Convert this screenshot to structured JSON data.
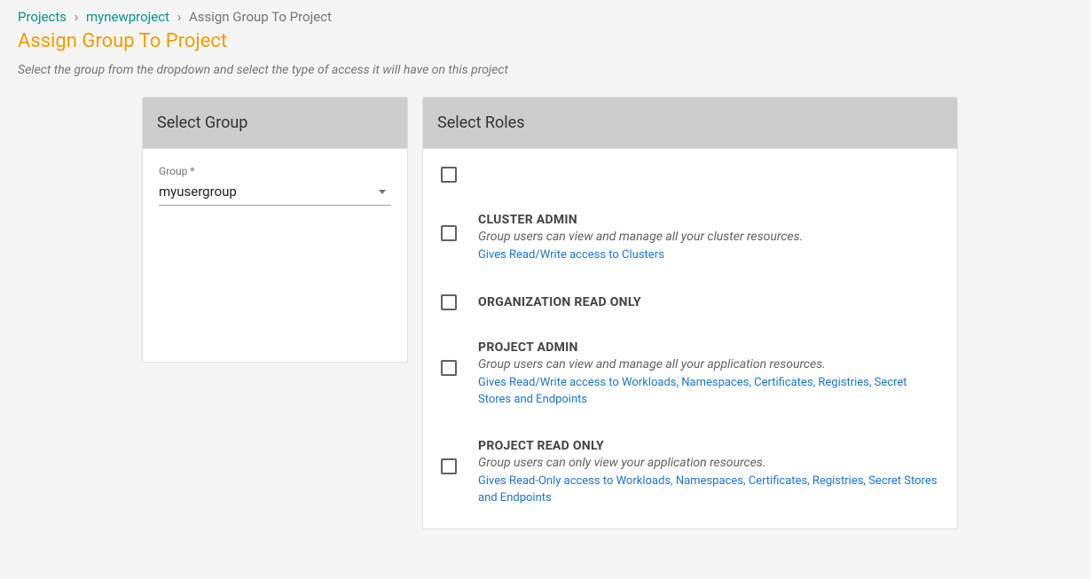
{
  "breadcrumb": {
    "projects": "Projects",
    "project_name": "mynewproject",
    "current": "Assign Group To Project"
  },
  "page_title": "Assign Group To Project",
  "subtitle": "Select the group from the dropdown and select the type of access it will have on this project",
  "group_panel": {
    "header": "Select Group",
    "field_label": "Group *",
    "selected": "myusergroup"
  },
  "roles_panel": {
    "header": "Select Roles",
    "roles": [
      {
        "name": "",
        "desc": "",
        "access": ""
      },
      {
        "name": "CLUSTER ADMIN",
        "desc": "Group users can view and manage all your cluster resources.",
        "access": "Gives Read/Write access to Clusters"
      },
      {
        "name": "ORGANIZATION READ ONLY",
        "desc": "",
        "access": ""
      },
      {
        "name": "PROJECT ADMIN",
        "desc": "Group users can view and manage all your application resources.",
        "access": "Gives Read/Write access to Workloads, Namespaces, Certificates, Registries, Secret Stores and Endpoints"
      },
      {
        "name": "PROJECT READ ONLY",
        "desc": "Group users can only view your application resources.",
        "access": "Gives Read-Only access to Workloads, Namespaces, Certificates, Registries, Secret Stores and Endpoints"
      }
    ]
  }
}
